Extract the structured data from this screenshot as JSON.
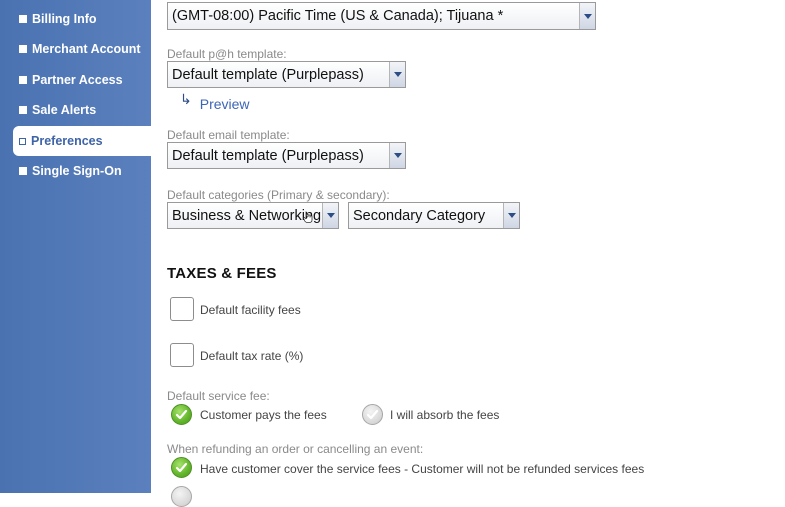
{
  "sidebar": {
    "items": [
      {
        "label": "Billing Info",
        "active": false
      },
      {
        "label": "Merchant Account",
        "active": false
      },
      {
        "label": "Partner Access",
        "active": false
      },
      {
        "label": "Sale Alerts",
        "active": false
      },
      {
        "label": "Preferences",
        "active": true
      },
      {
        "label": "Single Sign-On",
        "active": false
      }
    ]
  },
  "form": {
    "timezone": {
      "value": "(GMT-08:00) Pacific Time (US & Canada); Tijuana *"
    },
    "pah_template": {
      "label": "Default p@h template:",
      "value": "Default template (Purplepass)"
    },
    "preview_link": "Preview",
    "email_template": {
      "label": "Default email template:",
      "value": "Default template (Purplepass)"
    },
    "categories": {
      "label": "Default categories (Primary & secondary):",
      "primary": "Business & Networking",
      "secondary": "Secondary Category"
    }
  },
  "taxes": {
    "title": "TAXES & FEES",
    "facility_fees": {
      "label": "Default facility fees",
      "checked": false
    },
    "tax_rate": {
      "label": "Default tax rate (%)",
      "checked": false
    },
    "service_fee": {
      "label": "Default service fee:",
      "options": [
        {
          "label": "Customer pays the fees",
          "selected": true
        },
        {
          "label": "I will absorb the fees",
          "selected": false
        }
      ]
    },
    "refund": {
      "label": "When refunding an order or cancelling an event:",
      "options": [
        {
          "label": "Have customer cover the service fees - Customer will not be refunded services fees",
          "selected": true
        }
      ]
    }
  },
  "colors": {
    "sidebar": "#4a72b1",
    "accent": "#3e63a7",
    "link": "#3c66b5",
    "radio_selected": "#62b52a"
  }
}
